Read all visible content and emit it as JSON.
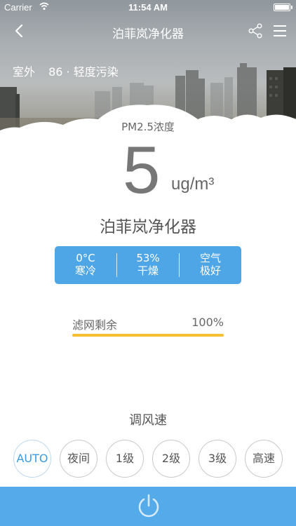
{
  "status_bar": {
    "carrier": "Carrier",
    "time": "11:54 AM"
  },
  "nav": {
    "title": "泊菲岚净化器",
    "back_icon": "chevron-left-icon",
    "share_icon": "share-icon",
    "menu_icon": "hamburger-menu-icon"
  },
  "outdoor": {
    "label": "室外",
    "aqi": "86 · 轻度污染"
  },
  "pm": {
    "label": "PM2.5浓度",
    "value": "5",
    "unit": "ug/m³"
  },
  "device": {
    "name": "泊菲岚净化器"
  },
  "environment": [
    {
      "line1": "0°C",
      "line2": "寒冷"
    },
    {
      "line1": "53%",
      "line2": "干燥"
    },
    {
      "line1": "空气",
      "line2": "极好"
    }
  ],
  "filter": {
    "label": "滤网剩余",
    "value": "100%",
    "fraction": 1.0
  },
  "fan": {
    "title": "调风速",
    "options": [
      "AUTO",
      "夜间",
      "1级",
      "2级",
      "3级",
      "高速"
    ],
    "selected": "AUTO"
  },
  "power": {
    "icon": "power-icon"
  },
  "colors": {
    "accent": "#4fa6e6",
    "filter_bar": "#f4c032",
    "power_bar": "#55aaea"
  }
}
